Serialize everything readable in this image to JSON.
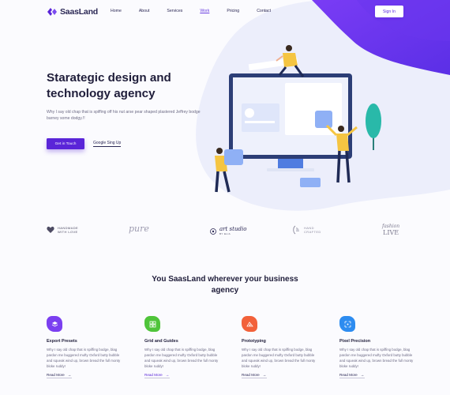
{
  "nav": {
    "logo": "SaasLand",
    "menu": [
      "Home",
      "About",
      "Services",
      "Work",
      "Pricing",
      "Contact"
    ],
    "active": "Work",
    "signin": "Sign In"
  },
  "hero": {
    "title": "Starategic design and technology agency",
    "text": "Why I say old chap that is spiffing off his nut arse pear shaped plastered Jeffrey bodge barney some dodgy.!!",
    "primary_button": "Get in Touch",
    "secondary_link": "Google Sing Up"
  },
  "brands": [
    {
      "line1": "HANDMADE",
      "line2": "WITH LOVE"
    },
    {
      "script": "pure"
    },
    {
      "script": "art studio",
      "sub": "BY ELIA"
    },
    {
      "line1": "HAND",
      "line2": "CRAFTED"
    },
    {
      "line1": "fashion",
      "line2": "LIVE"
    }
  ],
  "section": {
    "title": "You SaasLand wherever your business agency"
  },
  "features": [
    {
      "title": "Export Presets",
      "text": "Why I say old chap that is spiffing bodge, blag pardon me buggered mufty Oxford butty bubble and squeak wind up, brown bread the full monty bloke ruddy!",
      "link": "Read More",
      "color": "#7b3ff0",
      "icon": "layers-icon"
    },
    {
      "title": "Grid and Guides",
      "text": "Why I say old chap that is spiffing bodge, blag pardon me buggered mufty Oxford butty bubble and squeak wind up, brown bread the full monty bloke ruddy!",
      "link": "Read More",
      "color": "#4fc43a",
      "icon": "grid-icon"
    },
    {
      "title": "Prototyping",
      "text": "Why I say old chap that is spiffing bodge, blag pardon me buggered mufty Oxford butty bubble and squeak wind up, brown bread the full monty bloke ruddy!",
      "link": "Read More",
      "color": "#f2613a",
      "icon": "prototype-icon"
    },
    {
      "title": "Pixel Precision",
      "text": "Why I say old chap that is spiffing bodge, blag pardon me buggered mufty Oxford butty bubble and squeak wind up, brown bread the full monty bloke ruddy!",
      "link": "Read More",
      "color": "#2d8cf0",
      "icon": "precision-icon"
    }
  ],
  "colors": {
    "accent": "#5a25d8",
    "dark": "#1f1d3a"
  }
}
